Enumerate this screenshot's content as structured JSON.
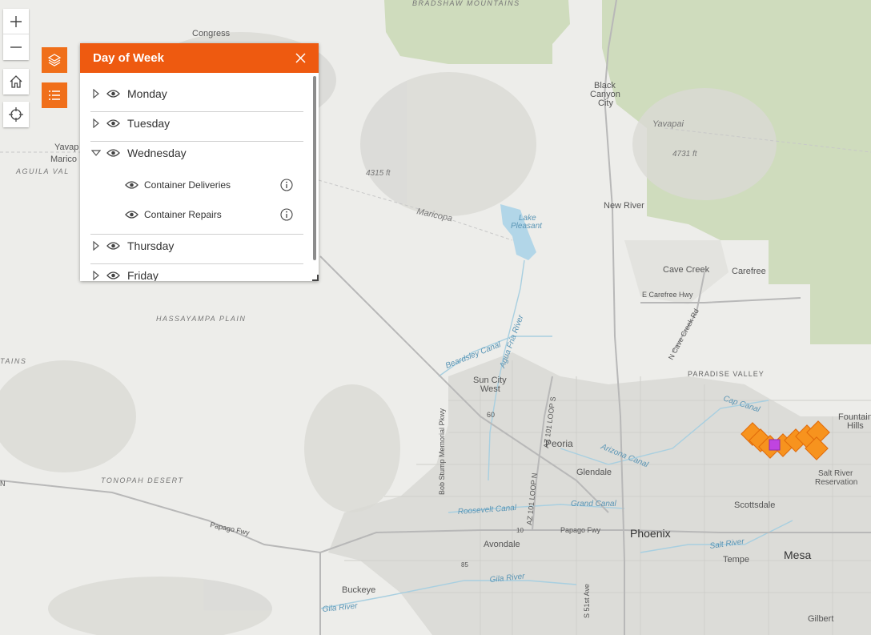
{
  "map": {
    "labels": {
      "bradshaw_mountains": "BRADSHAW MOUNTAINS",
      "congress": "Congress",
      "black_canyon_city": [
        "Black",
        "Canyon",
        "City"
      ],
      "yavapai_right": "Yavapai",
      "elev_4731": "4731 ft",
      "elev_4315": "4315 ft",
      "yavapai_left": "Yavap",
      "maricopa_left": "Marico",
      "aguila_valley": "AGUILA VAL",
      "maricopa_mid": "Maricopa",
      "lake_pleasant": [
        "Lake",
        "Pleasant"
      ],
      "new_river": "New River",
      "cave_creek": "Cave Creek",
      "carefree": "Carefree",
      "e_carefree_hwy": "E Carefree Hwy",
      "n_cave_creek_rd": "N Cave Creek Rd",
      "hassayampa_plain": "HASSAYAMPA PLAIN",
      "mountains_left": "TAINS",
      "agua_fria_river": "Agua Fria River",
      "beardsley_canal": "Beardsley Canal",
      "paradise_valley": "PARADISE VALLEY",
      "cap_canal": "Cap Canal",
      "sun_city_west": [
        "Sun City",
        "West"
      ],
      "route_60": "60",
      "az_101_loop_s": "AZ 101 LOOP S",
      "bob_stump_pkwy": "Bob Stump Memorial Pkwy",
      "peoria": "Peoria",
      "arizona_canal": "Arizona Canal",
      "fountain_hills": [
        "Fountain",
        "Hills"
      ],
      "salt_river_reservation": [
        "Salt River",
        "Reservation"
      ],
      "glendale": "Glendale",
      "tonopah_desert": "TONOPAH DESERT",
      "az_101_loop_n": "AZ 101 LOOP N",
      "roosevelt_canal": "Roosevelt Canal",
      "grand_canal": "Grand Canal",
      "scottsdale": "Scottsdale",
      "left_edge_n": "N",
      "papago_fwy_left": "Papago Fwy",
      "route_10": "10",
      "papago_fwy_right": "Papago Fwy",
      "phoenix": "Phoenix",
      "avondale": "Avondale",
      "salt_river": "Salt River",
      "tempe": "Tempe",
      "mesa": "Mesa",
      "route_85": "85",
      "gila_river_mid": "Gila River",
      "buckeye": "Buckeye",
      "gila_river_left": "Gila River",
      "s_51st_ave": "S 51st Ave",
      "gilbert": "Gilbert"
    },
    "colors": {
      "background": "#ededea",
      "forest": "#cfdcbd",
      "urban": "#dcdcd8",
      "water": "#b2d6e8",
      "road": "#b8b8b8",
      "marker": "#f7931e",
      "marker_selected": "#c044e0"
    }
  },
  "controls": {
    "zoom_in_icon": "plus-icon",
    "zoom_out_icon": "minus-icon",
    "home_icon": "home-icon",
    "locate_icon": "crosshair-icon",
    "layers_icon": "layers-icon",
    "legend_icon": "list-icon",
    "accent": "#f06f1a"
  },
  "panel": {
    "title": "Day of Week",
    "close_icon": "close-icon",
    "header_color": "#ee5a10",
    "days": [
      {
        "label": "Monday",
        "expanded": false
      },
      {
        "label": "Tuesday",
        "expanded": false
      },
      {
        "label": "Wednesday",
        "expanded": true,
        "sublayers": [
          {
            "label": "Container Deliveries"
          },
          {
            "label": "Container Repairs"
          }
        ]
      },
      {
        "label": "Thursday",
        "expanded": false
      },
      {
        "label": "Friday",
        "expanded": false
      }
    ]
  }
}
